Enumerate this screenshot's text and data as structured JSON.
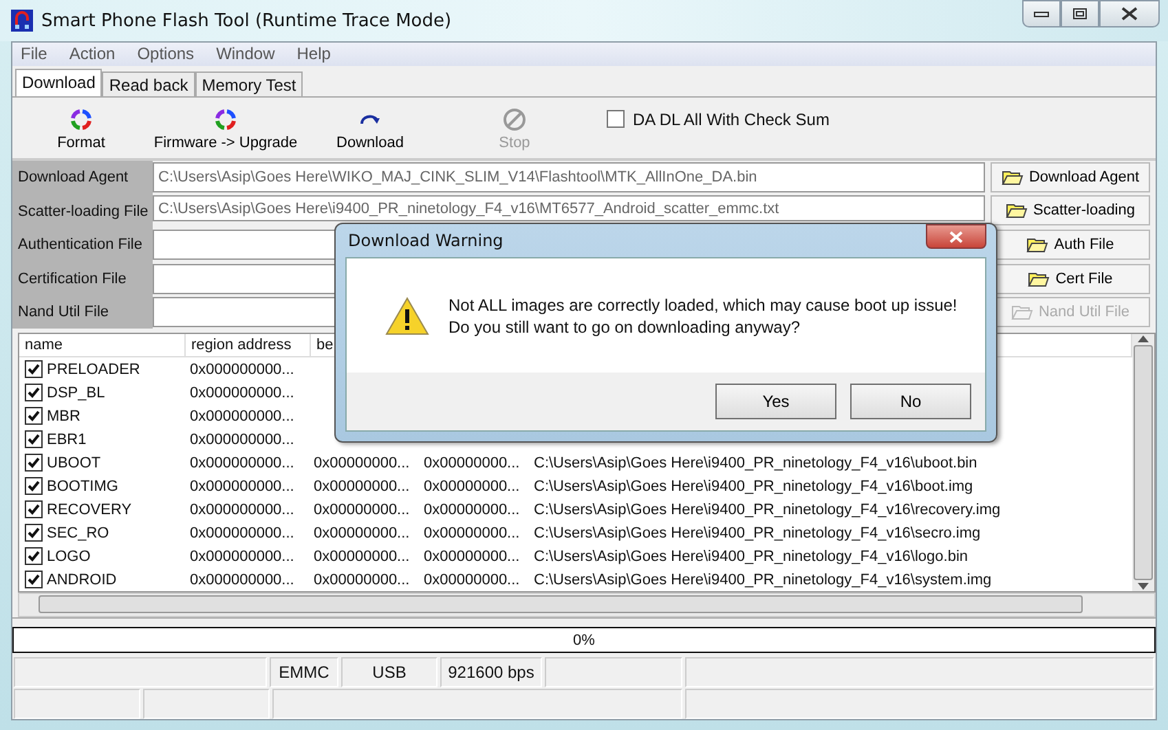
{
  "window": {
    "title": "Smart Phone Flash Tool (Runtime Trace Mode)"
  },
  "menu": [
    "File",
    "Action",
    "Options",
    "Window",
    "Help"
  ],
  "tabs": [
    {
      "label": "Download",
      "selected": true
    },
    {
      "label": "Read back",
      "selected": false
    },
    {
      "label": "Memory Test",
      "selected": false
    }
  ],
  "toolbar": [
    {
      "label": "Format",
      "kind": "format",
      "disabled": false
    },
    {
      "label": "Firmware -> Upgrade",
      "kind": "upgrade",
      "disabled": false
    },
    {
      "label": "Download",
      "kind": "download",
      "disabled": false
    },
    {
      "label": "Stop",
      "kind": "stop",
      "disabled": true
    }
  ],
  "checksum": {
    "label": "DA DL All With Check Sum",
    "checked": false
  },
  "files": [
    {
      "label": "Download Agent",
      "value": "C:\\Users\\Asip\\Goes Here\\WIKO_MAJ_CINK_SLIM_V14\\Flashtool\\MTK_AllInOne_DA.bin",
      "button": "Download Agent",
      "disabled": false
    },
    {
      "label": "Scatter-loading File",
      "value": "C:\\Users\\Asip\\Goes Here\\i9400_PR_ninetology_F4_v16\\MT6577_Android_scatter_emmc.txt",
      "button": "Scatter-loading",
      "disabled": false
    },
    {
      "label": "Authentication File",
      "button": "Auth File",
      "disabled": false
    },
    {
      "label": "Certification File",
      "button": "Cert File",
      "disabled": false
    },
    {
      "label": "Nand Util File",
      "button": "Nand Util File",
      "disabled": true
    }
  ],
  "table": {
    "columns": [
      "name",
      "region address",
      "be"
    ],
    "rows": [
      {
        "checked": true,
        "cells": [
          "PRELOADER",
          "0x000000000..."
        ]
      },
      {
        "checked": true,
        "cells": [
          "DSP_BL",
          "0x000000000..."
        ]
      },
      {
        "checked": true,
        "cells": [
          "MBR",
          "0x000000000..."
        ]
      },
      {
        "checked": true,
        "cells": [
          "EBR1",
          "0x000000000..."
        ]
      },
      {
        "checked": true,
        "cells": [
          "UBOOT",
          "0x000000000...",
          "0x00000000...",
          "0x00000000...",
          "C:\\Users\\Asip\\Goes Here\\i9400_PR_ninetology_F4_v16\\uboot.bin"
        ]
      },
      {
        "checked": true,
        "cells": [
          "BOOTIMG",
          "0x000000000...",
          "0x00000000...",
          "0x00000000...",
          "C:\\Users\\Asip\\Goes Here\\i9400_PR_ninetology_F4_v16\\boot.img"
        ]
      },
      {
        "checked": true,
        "cells": [
          "RECOVERY",
          "0x000000000...",
          "0x00000000...",
          "0x00000000...",
          "C:\\Users\\Asip\\Goes Here\\i9400_PR_ninetology_F4_v16\\recovery.img"
        ]
      },
      {
        "checked": true,
        "cells": [
          "SEC_RO",
          "0x000000000...",
          "0x00000000...",
          "0x00000000...",
          "C:\\Users\\Asip\\Goes Here\\i9400_PR_ninetology_F4_v16\\secro.img"
        ]
      },
      {
        "checked": true,
        "cells": [
          "LOGO",
          "0x000000000...",
          "0x00000000...",
          "0x00000000...",
          "C:\\Users\\Asip\\Goes Here\\i9400_PR_ninetology_F4_v16\\logo.bin"
        ]
      },
      {
        "checked": true,
        "cells": [
          "ANDROID",
          "0x000000000...",
          "0x00000000...",
          "0x00000000...",
          "C:\\Users\\Asip\\Goes Here\\i9400_PR_ninetology_F4_v16\\system.img"
        ]
      }
    ]
  },
  "progress": {
    "text": "0%",
    "level": 0
  },
  "status_bar": [
    "EMMC",
    "USB",
    "921600 bps"
  ],
  "dialog": {
    "title": "Download Warning",
    "message": [
      "Not ALL images are correctly loaded, which may cause boot up issue!",
      "Do you still want to go on downloading anyway?"
    ],
    "buttons": [
      "Yes",
      "No"
    ]
  }
}
